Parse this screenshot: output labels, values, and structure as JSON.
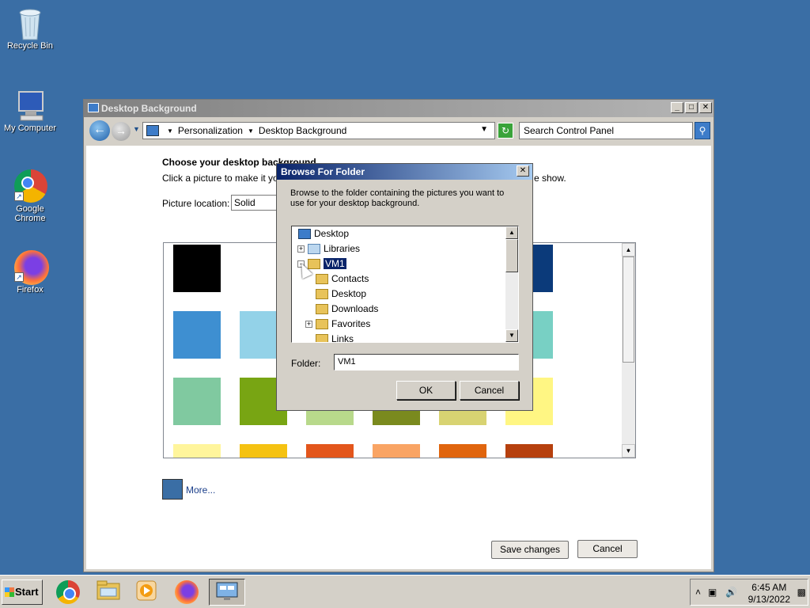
{
  "desktop": {
    "icons": [
      {
        "label": "Recycle Bin",
        "icon": "recycle-bin-icon"
      },
      {
        "label": "My Computer",
        "icon": "computer-icon"
      },
      {
        "label": "Google Chrome",
        "icon": "chrome-icon"
      },
      {
        "label": "Firefox",
        "icon": "firefox-icon"
      }
    ]
  },
  "window": {
    "title": "Desktop Background",
    "controls": {
      "minimize": "_",
      "maximize": "□",
      "close": "✕"
    },
    "address": {
      "part1": "Personalization",
      "part2": "Desktop Background"
    },
    "search_placeholder": "Search Control Panel",
    "heading": "Choose your desktop background",
    "subtext": "Click a picture to make it your d",
    "subtext_end": "e show.",
    "picture_location_label": "Picture location:",
    "picture_location_value": "Solid Colors",
    "swatch_colors": [
      "#000000",
      "#0b3a7a",
      "#3e8fd1",
      "#93d2e8",
      "#78d0c4",
      "#80c9a0",
      "#78a513",
      "#b8d98b",
      "#7a8a1e",
      "#d8d372",
      "#fff683",
      "#fff59c",
      "#f5c212",
      "#e3561c",
      "#f9a464",
      "#e0650e",
      "#b6400e"
    ],
    "more_label": "More...",
    "more_color": "#3a6ea5",
    "save_button": "Save changes",
    "cancel_button": "Cancel"
  },
  "dialog": {
    "title": "Browse For Folder",
    "close": "✕",
    "message": "Browse to the folder containing the pictures you want to use for your desktop background.",
    "tree": [
      {
        "label": "Desktop",
        "icon": "desktop-icon",
        "expander": ""
      },
      {
        "label": "Libraries",
        "icon": "libraries-icon",
        "expander": "+"
      },
      {
        "label": "VM1",
        "icon": "user-folder-icon",
        "expander": "-",
        "selected": true
      },
      {
        "label": "Contacts",
        "icon": "contacts-folder-icon",
        "expander": ""
      },
      {
        "label": "Desktop",
        "icon": "desktop-folder-icon",
        "expander": ""
      },
      {
        "label": "Downloads",
        "icon": "downloads-folder-icon",
        "expander": ""
      },
      {
        "label": "Favorites",
        "icon": "favorites-folder-icon",
        "expander": "+"
      },
      {
        "label": "Links",
        "icon": "links-folder-icon",
        "expander": ""
      }
    ],
    "folder_label": "Folder:",
    "folder_value": "VM1",
    "ok_button": "OK",
    "cancel_button": "Cancel"
  },
  "taskbar": {
    "start_label": "Start",
    "items": [
      {
        "icon": "chrome-icon"
      },
      {
        "icon": "file-explorer-icon"
      },
      {
        "icon": "media-player-icon"
      },
      {
        "icon": "firefox-icon"
      },
      {
        "icon": "control-panel-icon",
        "active": true
      }
    ],
    "time": "6:45 AM",
    "date": "9/13/2022"
  }
}
